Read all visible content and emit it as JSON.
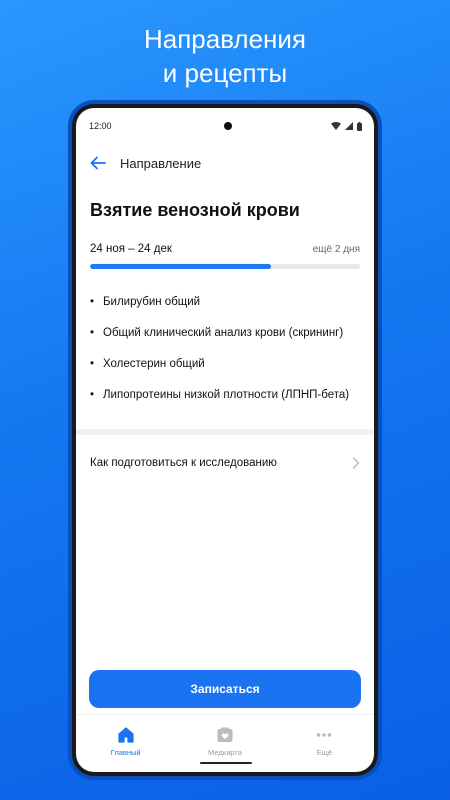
{
  "promo": {
    "line1": "Направления",
    "line2": "и рецепты"
  },
  "status_bar": {
    "time": "12:00"
  },
  "appbar": {
    "title": "Направление"
  },
  "page": {
    "title": "Взятие венозной крови",
    "period": "24 ноя – 24 дек",
    "remaining": "ещё 2 дня",
    "progress_fraction": 0.67
  },
  "tests": [
    "Билирубин общий",
    "Общий клинический анализ крови (скрининг)",
    "Холестерин общий",
    "Липопротеины низкой плотности (ЛПНП-бета)"
  ],
  "prep_link": {
    "label": "Как подготовиться к исследованию"
  },
  "cta": {
    "label": "Записаться"
  },
  "tabbar": {
    "items": [
      {
        "label": "Главный",
        "icon": "home-icon",
        "active": true
      },
      {
        "label": "Медкарта",
        "icon": "medcard-icon",
        "active": false
      },
      {
        "label": "Ещё",
        "icon": "more-icon",
        "active": false
      }
    ]
  },
  "colors": {
    "accent": "#1a73f0",
    "background": "#1378f0"
  }
}
